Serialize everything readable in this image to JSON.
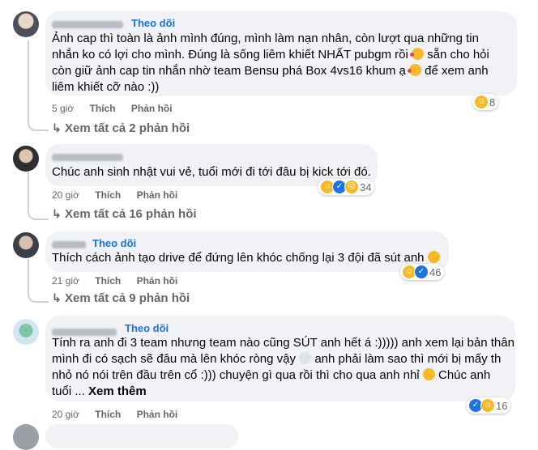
{
  "comments": [
    {
      "author": "",
      "follow": "Theo dõi",
      "lines": [
        "Ảnh cap thì toàn là ảnh mình đúng, mình làm nạn nhân, còn lượt qua những tin",
        "nhắn ko có lợi cho mình. Đúng là sống liêm khiết NHẤT pubgm rồi",
        "sẵn cho hỏi",
        "còn giữ ảnh cap tin nhắn nhờ team Bensu phá Box 4vs16 khum ạ",
        "để xem anh",
        "liêm khiết cỡ nào :))"
      ],
      "time": "5 giờ",
      "like": "Thích",
      "reply": "Phản hồi",
      "reactions": [
        "haha"
      ],
      "reaction_count": "8",
      "view_replies": "Xem tất cả 2 phản hồi"
    },
    {
      "author": "",
      "follow": "",
      "lines": [
        "Chúc anh sinh nhật vui vẻ, tuổi mới đi tới đâu bị kick tới đó."
      ],
      "time": "20 giờ",
      "like": "Thích",
      "reply": "Phản hồi",
      "reactions": [
        "haha",
        "like",
        "sad"
      ],
      "reaction_count": "34",
      "view_replies": "Xem tất cả 16 phản hồi"
    },
    {
      "author": "",
      "follow": "Theo dõi",
      "lines": [
        "Thích cách ảnh tạo drive để đứng lên khóc chống lại 3 đội đã sút anh"
      ],
      "time": "21 giờ",
      "like": "Thích",
      "reply": "Phản hồi",
      "reactions": [
        "haha",
        "like"
      ],
      "reaction_count": "46",
      "view_replies": "Xem tất cả 9 phản hồi"
    },
    {
      "author": "",
      "follow": "Theo dõi",
      "lines": [
        "Tính ra anh đi 3 team nhưng team nào cũng SÚT anh hết á :))))) anh xem lại bản thân",
        "mình đi có sạch sẽ đâu mà lên khóc ròng vậy",
        "anh phải làm sao thì mới bị mấy th",
        "nhỏ nó nói trên đầu trên cổ :))) chuyện gì qua rồi thì cho qua anh nhỉ",
        "Chúc anh",
        "tuổi ... ",
        "Xem thêm"
      ],
      "time": "20 giờ",
      "like": "Thích",
      "reply": "Phản hồi",
      "reactions": [
        "like",
        "haha"
      ],
      "reaction_count": "16"
    }
  ]
}
